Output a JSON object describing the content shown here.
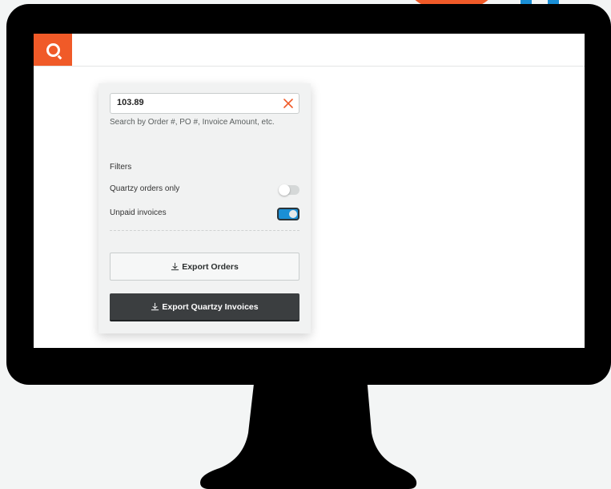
{
  "app": {
    "brand_color": "#f05a28",
    "accent_color": "#1a8fd6",
    "logo_icon": "quartzy-q-logo"
  },
  "search": {
    "value": "103.89",
    "hint": "Search by Order #, PO #, Invoice Amount, etc.",
    "clear_icon": "close-icon"
  },
  "filters": {
    "title": "Filters",
    "items": [
      {
        "label": "Quartzy orders only",
        "enabled": false
      },
      {
        "label": "Unpaid invoices",
        "enabled": true
      }
    ]
  },
  "actions": {
    "export_orders_label": "Export Orders",
    "export_invoices_label": "Export Quartzy Invoices",
    "icon": "download-icon"
  }
}
